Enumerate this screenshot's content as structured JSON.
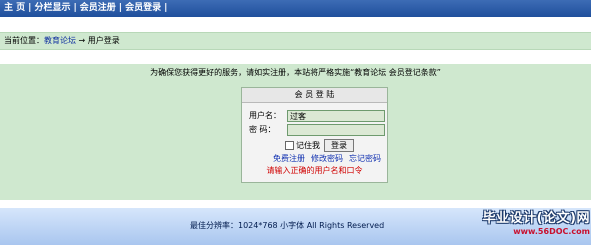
{
  "nav": {
    "items": [
      "主 页",
      "分栏显示",
      "会员注册",
      "会员登录"
    ],
    "trailing_sep": "|"
  },
  "breadcrumb": {
    "prefix": "当前位置：",
    "forum": "教育论坛",
    "arrow": "→",
    "current": "用户登录"
  },
  "notice": "为确保您获得更好的服务，请如实注册，本站将严格实施“教育论坛 会员登记条款”",
  "login": {
    "title": "会 员 登 陆",
    "username_label": "用户名：",
    "username_value": "过客",
    "password_label": "密  码：",
    "password_value": "",
    "remember_label": "记住我",
    "submit_label": "登录",
    "links": [
      "免费注册",
      "修改密码",
      "忘记密码"
    ],
    "error": "请输入正确的用户名和口令"
  },
  "footer": {
    "text": "最佳分辨率：1024*768  小字体 All Rights Reserved"
  },
  "watermark": {
    "title": "毕业设计(论文)网",
    "url": "www.56DOC.com"
  },
  "colors": {
    "topbar": "#2a5aa8",
    "panel_green": "#cfe8cf",
    "error_red": "#d00000",
    "link_blue": "#1030b0"
  }
}
